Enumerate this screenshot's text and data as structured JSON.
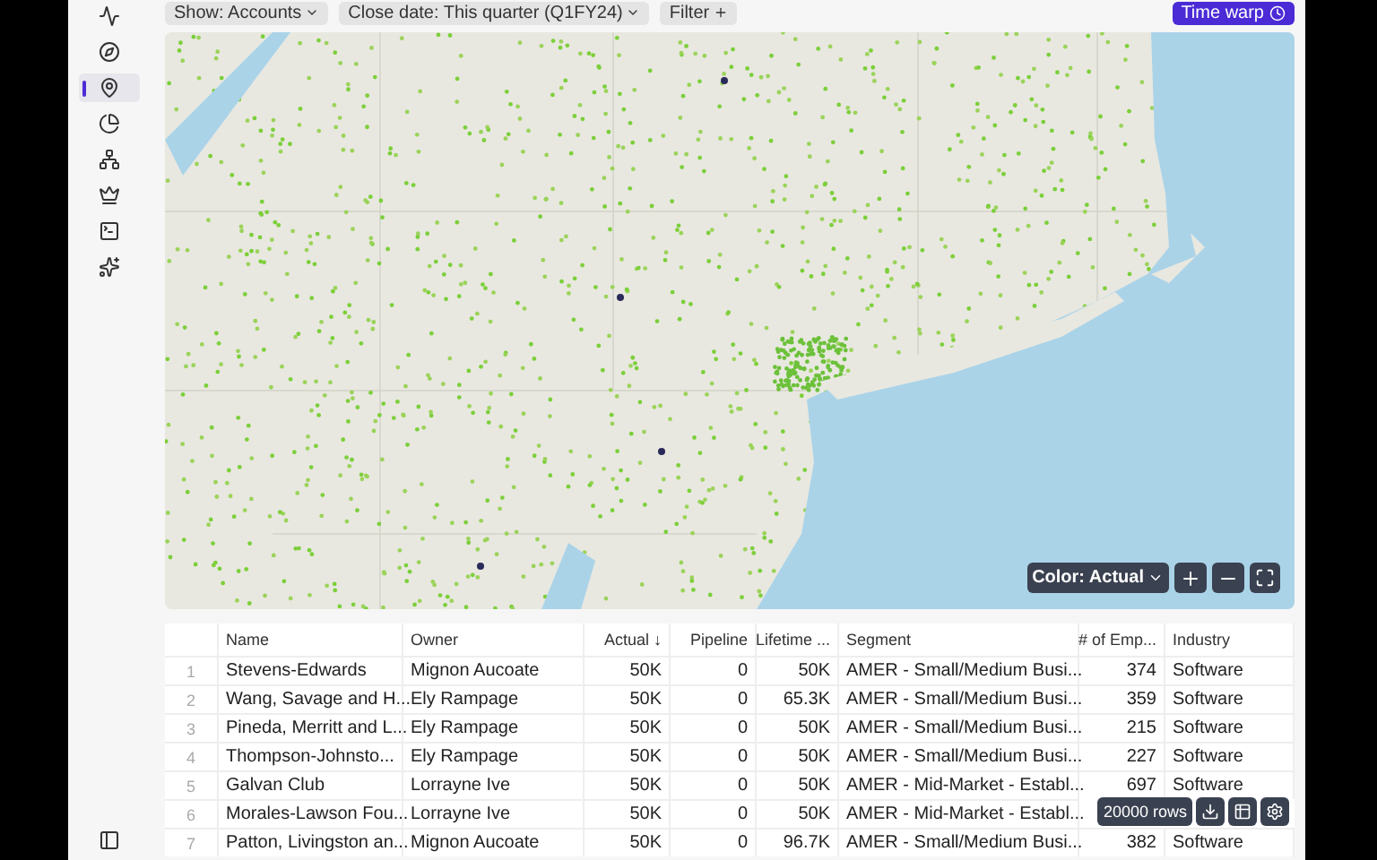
{
  "sidebar": {
    "items": [
      {
        "kind": "activity",
        "selected": false
      },
      {
        "kind": "compass",
        "selected": false
      },
      {
        "kind": "pin",
        "selected": true
      },
      {
        "kind": "pie",
        "selected": false
      },
      {
        "kind": "hierarchy",
        "selected": false
      },
      {
        "kind": "podium",
        "selected": false
      },
      {
        "kind": "terminal",
        "selected": false
      },
      {
        "kind": "sparkles",
        "selected": false
      }
    ]
  },
  "toolbar": {
    "filters": [
      "Show: Accounts",
      "Close date: This quarter (Q1FY24)"
    ],
    "filter_button": "Filter",
    "time_warp": "Time warp"
  },
  "map": {
    "color_button": "Color: Actual"
  },
  "table": {
    "columns": [
      {
        "label": "Name",
        "kind": "text"
      },
      {
        "label": "Owner",
        "kind": "text"
      },
      {
        "label": "Actual ↓",
        "kind": "number"
      },
      {
        "label": "Pipeline",
        "kind": "number"
      },
      {
        "label": "Lifetime ...",
        "kind": "number"
      },
      {
        "label": "Segment",
        "kind": "text"
      },
      {
        "label": "# of Emp...",
        "kind": "number"
      },
      {
        "label": "Industry",
        "kind": "text"
      }
    ],
    "rows": [
      {
        "number": "1",
        "cells": [
          "Stevens-Edwards",
          "Mignon Aucoate",
          "50K",
          "0",
          "50K",
          "AMER - Small/Medium Busi...",
          "374",
          "Software"
        ]
      },
      {
        "number": "2",
        "cells": [
          "Wang, Savage and H...",
          "Ely Rampage",
          "50K",
          "0",
          "65.3K",
          "AMER - Small/Medium Busi...",
          "359",
          "Software"
        ]
      },
      {
        "number": "3",
        "cells": [
          "Pineda, Merritt and L...",
          "Ely Rampage",
          "50K",
          "0",
          "50K",
          "AMER - Small/Medium Busi...",
          "215",
          "Software"
        ]
      },
      {
        "number": "4",
        "cells": [
          "Thompson-Johnsto...",
          "Ely Rampage",
          "50K",
          "0",
          "50K",
          "AMER - Small/Medium Busi...",
          "227",
          "Software"
        ]
      },
      {
        "number": "5",
        "cells": [
          "Galvan Club",
          "Lorrayne Ive",
          "50K",
          "0",
          "50K",
          "AMER - Mid-Market - Establ...",
          "697",
          "Software"
        ]
      },
      {
        "number": "6",
        "cells": [
          "Morales-Lawson Fou...",
          "Lorrayne Ive",
          "50K",
          "0",
          "50K",
          "AMER - Mid-Market - Establ..."
        ]
      },
      {
        "number": "7",
        "cells": [
          "Patton, Livingston an...",
          "Mignon Aucoate",
          "50K",
          "0",
          "96.7K",
          "AMER - Small/Medium Busi...",
          "382",
          "Software"
        ]
      }
    ],
    "row_count": "20000 rows"
  }
}
